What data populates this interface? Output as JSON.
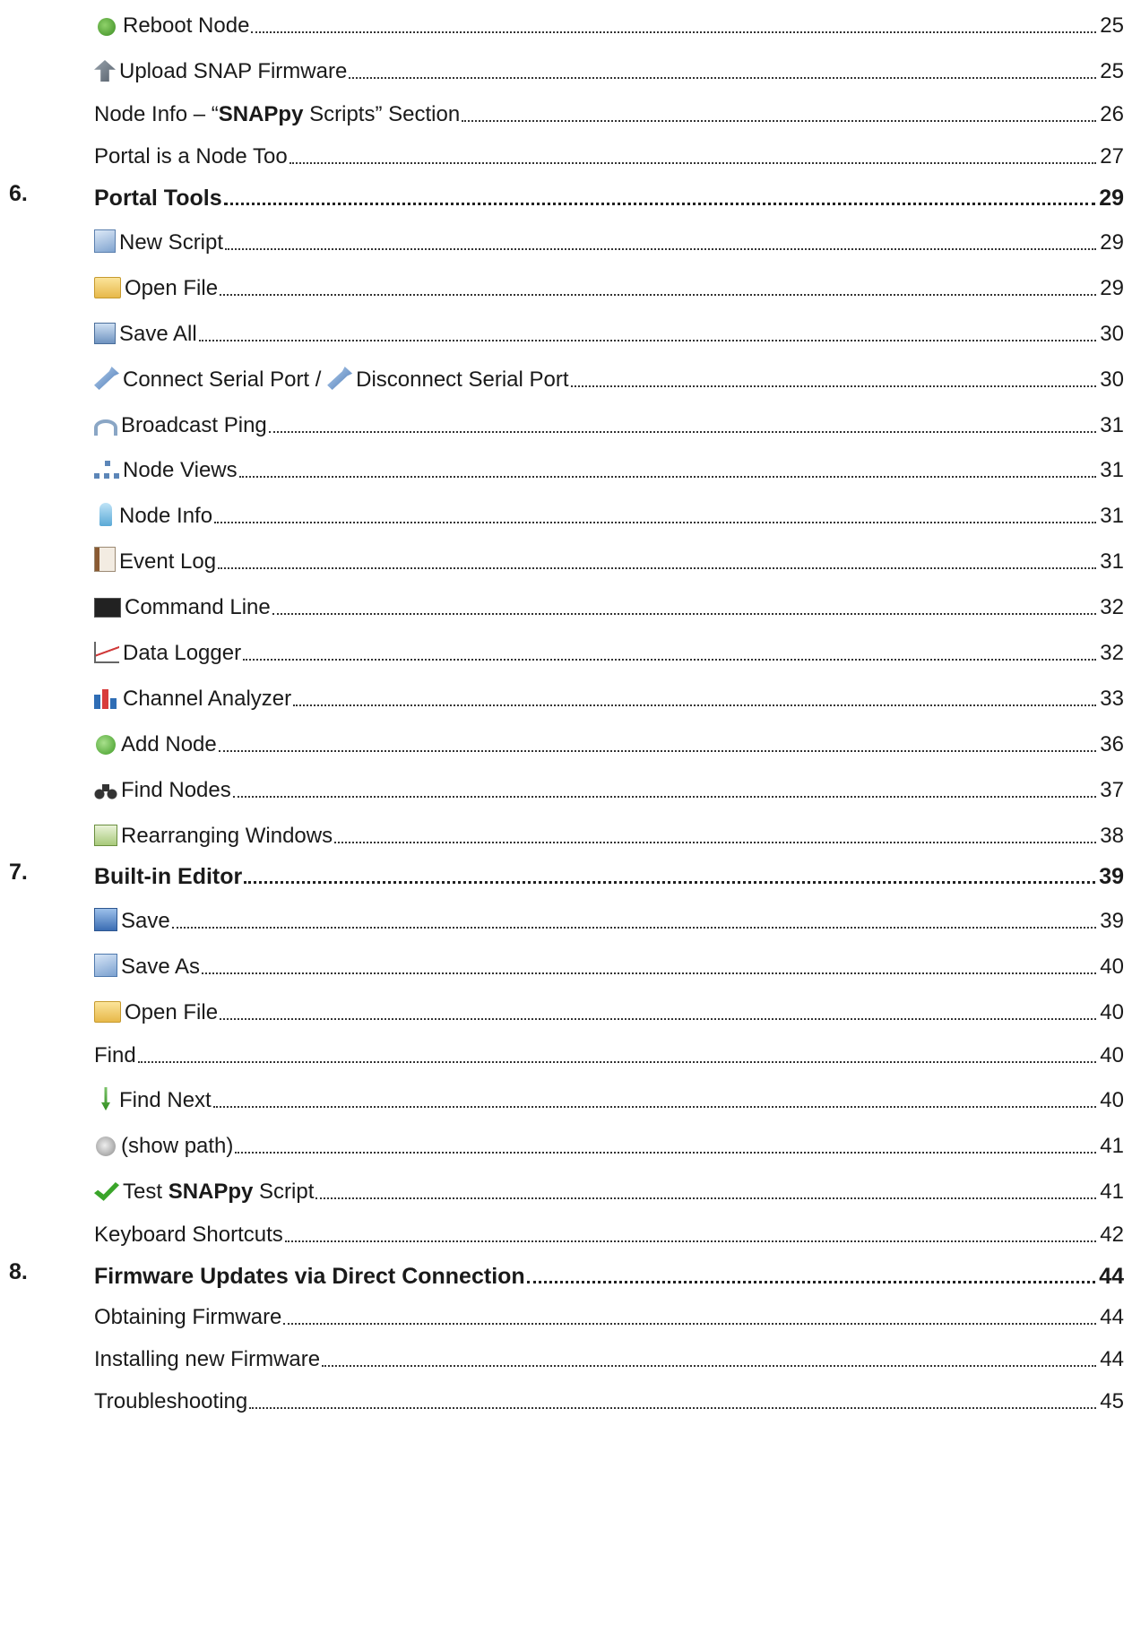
{
  "toc": [
    {
      "type": "entry",
      "icon": "reboot-icon",
      "label": "Reboot Node",
      "page": "25"
    },
    {
      "type": "entry",
      "icon": "upload-firmware-icon",
      "label": "Upload SNAP Firmware",
      "page": "25"
    },
    {
      "type": "entry",
      "icon": "",
      "label_parts": [
        "Node Info – “",
        "SNAPpy",
        " Scripts” Section"
      ],
      "page": "26"
    },
    {
      "type": "entry",
      "icon": "",
      "label": "Portal is a Node Too",
      "page": "27"
    },
    {
      "type": "chapter",
      "num": "6.",
      "label": "Portal Tools",
      "page": "29"
    },
    {
      "type": "entry",
      "icon": "new-script-icon",
      "label": "New Script",
      "page": "29"
    },
    {
      "type": "entry",
      "icon": "open-folder-icon",
      "label": "Open File",
      "page": "29"
    },
    {
      "type": "entry",
      "icon": "save-all-icon",
      "label": "Save All",
      "page": "30"
    },
    {
      "type": "entry",
      "icon": "serial-plug-icon",
      "label": "Connect Serial Port / ",
      "label2": "Disconnect Serial Port",
      "page": "30"
    },
    {
      "type": "entry",
      "icon": "broadcast-ping-icon",
      "label": "Broadcast Ping",
      "page": "31"
    },
    {
      "type": "entry",
      "icon": "node-views-icon",
      "label": "Node Views",
      "page": "31"
    },
    {
      "type": "entry",
      "icon": "node-info-icon",
      "label": "Node Info",
      "page": "31"
    },
    {
      "type": "entry",
      "icon": "event-log-icon",
      "label": "Event Log",
      "page": "31"
    },
    {
      "type": "entry",
      "icon": "command-line-icon",
      "label": "Command Line",
      "page": "32"
    },
    {
      "type": "entry",
      "icon": "data-logger-icon",
      "label": "Data Logger",
      "page": "32"
    },
    {
      "type": "entry",
      "icon": "channel-analyzer-icon",
      "label": "Channel Analyzer",
      "page": "33"
    },
    {
      "type": "entry",
      "icon": "add-node-icon",
      "label": "Add Node",
      "page": "36"
    },
    {
      "type": "entry",
      "icon": "find-nodes-icon",
      "label": "Find Nodes",
      "page": "37"
    },
    {
      "type": "entry",
      "icon": "rearrange-windows-icon",
      "label": "Rearranging Windows",
      "page": "38"
    },
    {
      "type": "chapter",
      "num": "7.",
      "label": "Built-in Editor",
      "page": "39"
    },
    {
      "type": "entry",
      "icon": "save-disk-icon",
      "label": "Save",
      "page": "39"
    },
    {
      "type": "entry",
      "icon": "save-as-icon",
      "label": "Save As",
      "page": "40"
    },
    {
      "type": "entry",
      "icon": "open-folder-icon",
      "label": "Open File",
      "page": "40"
    },
    {
      "type": "entry",
      "icon": "",
      "label": "Find",
      "page": "40"
    },
    {
      "type": "entry",
      "icon": "find-next-arrow-icon",
      "label": "Find Next",
      "page": "40"
    },
    {
      "type": "entry",
      "icon": "show-path-icon",
      "label": "(show path)",
      "page": "41"
    },
    {
      "type": "entry",
      "icon": "check-icon",
      "label_parts": [
        "Test ",
        "SNAPpy",
        " Script"
      ],
      "page": "41"
    },
    {
      "type": "entry",
      "icon": "",
      "label": "Keyboard Shortcuts",
      "page": "42"
    },
    {
      "type": "chapter",
      "num": "8.",
      "label": "Firmware Updates via Direct Connection",
      "page": "44"
    },
    {
      "type": "entry",
      "icon": "",
      "label": "Obtaining Firmware",
      "page": "44"
    },
    {
      "type": "entry",
      "icon": "",
      "label": "Installing new Firmware",
      "page": "44"
    },
    {
      "type": "entry",
      "icon": "",
      "label": "Troubleshooting",
      "page": "45"
    }
  ]
}
